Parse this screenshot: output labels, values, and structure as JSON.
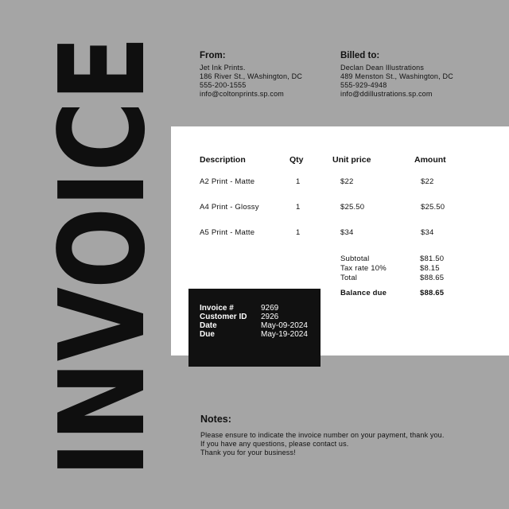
{
  "title": "INVOICE",
  "from": {
    "heading": "From:",
    "lines": [
      "Jet Ink Prints.",
      "186 River St., WAshington, DC",
      "555-200-1555",
      "info@coltonprints.sp.com"
    ]
  },
  "billed_to": {
    "heading": "Billed to:",
    "lines": [
      "Declan Dean Illustrations",
      "489 Menston St., Washington, DC",
      "555-929-4948",
      "info@ddillustrations.sp.com"
    ]
  },
  "table": {
    "headers": [
      "Description",
      "Qty",
      "Unit price",
      "Amount"
    ],
    "rows": [
      [
        "A2 Print - Matte",
        "1",
        "$22",
        "$22"
      ],
      [
        "A4 Print - Glossy",
        "1",
        "$25.50",
        "$25.50"
      ],
      [
        "A5 Print - Matte",
        "1",
        "$34",
        "$34"
      ]
    ]
  },
  "summary": {
    "subtotal_label": "Subtotal",
    "subtotal_value": "$81.50",
    "tax_label": "Tax rate 10%",
    "tax_value": "$8.15",
    "total_label": "Total",
    "total_value": "$88.65",
    "balance_label": "Balance due",
    "balance_value": "$88.65"
  },
  "meta": {
    "invoice_label": "Invoice #",
    "invoice_value": "9269",
    "customer_label": "Customer ID",
    "customer_value": "2926",
    "date_label": "Date",
    "date_value": "May-09-2024",
    "due_label": "Due",
    "due_value": "May-19-2024"
  },
  "notes": {
    "heading": "Notes:",
    "lines": [
      "Please ensure to indicate the invoice number on your payment, thank you.",
      "If you have any questions, please contact us.",
      "Thank you for your business!"
    ]
  },
  "colors": {
    "background": "#a5a5a5",
    "paper": "#ffffff",
    "ink": "#111111",
    "meta_box": "#111111",
    "meta_text": "#ffffff"
  }
}
